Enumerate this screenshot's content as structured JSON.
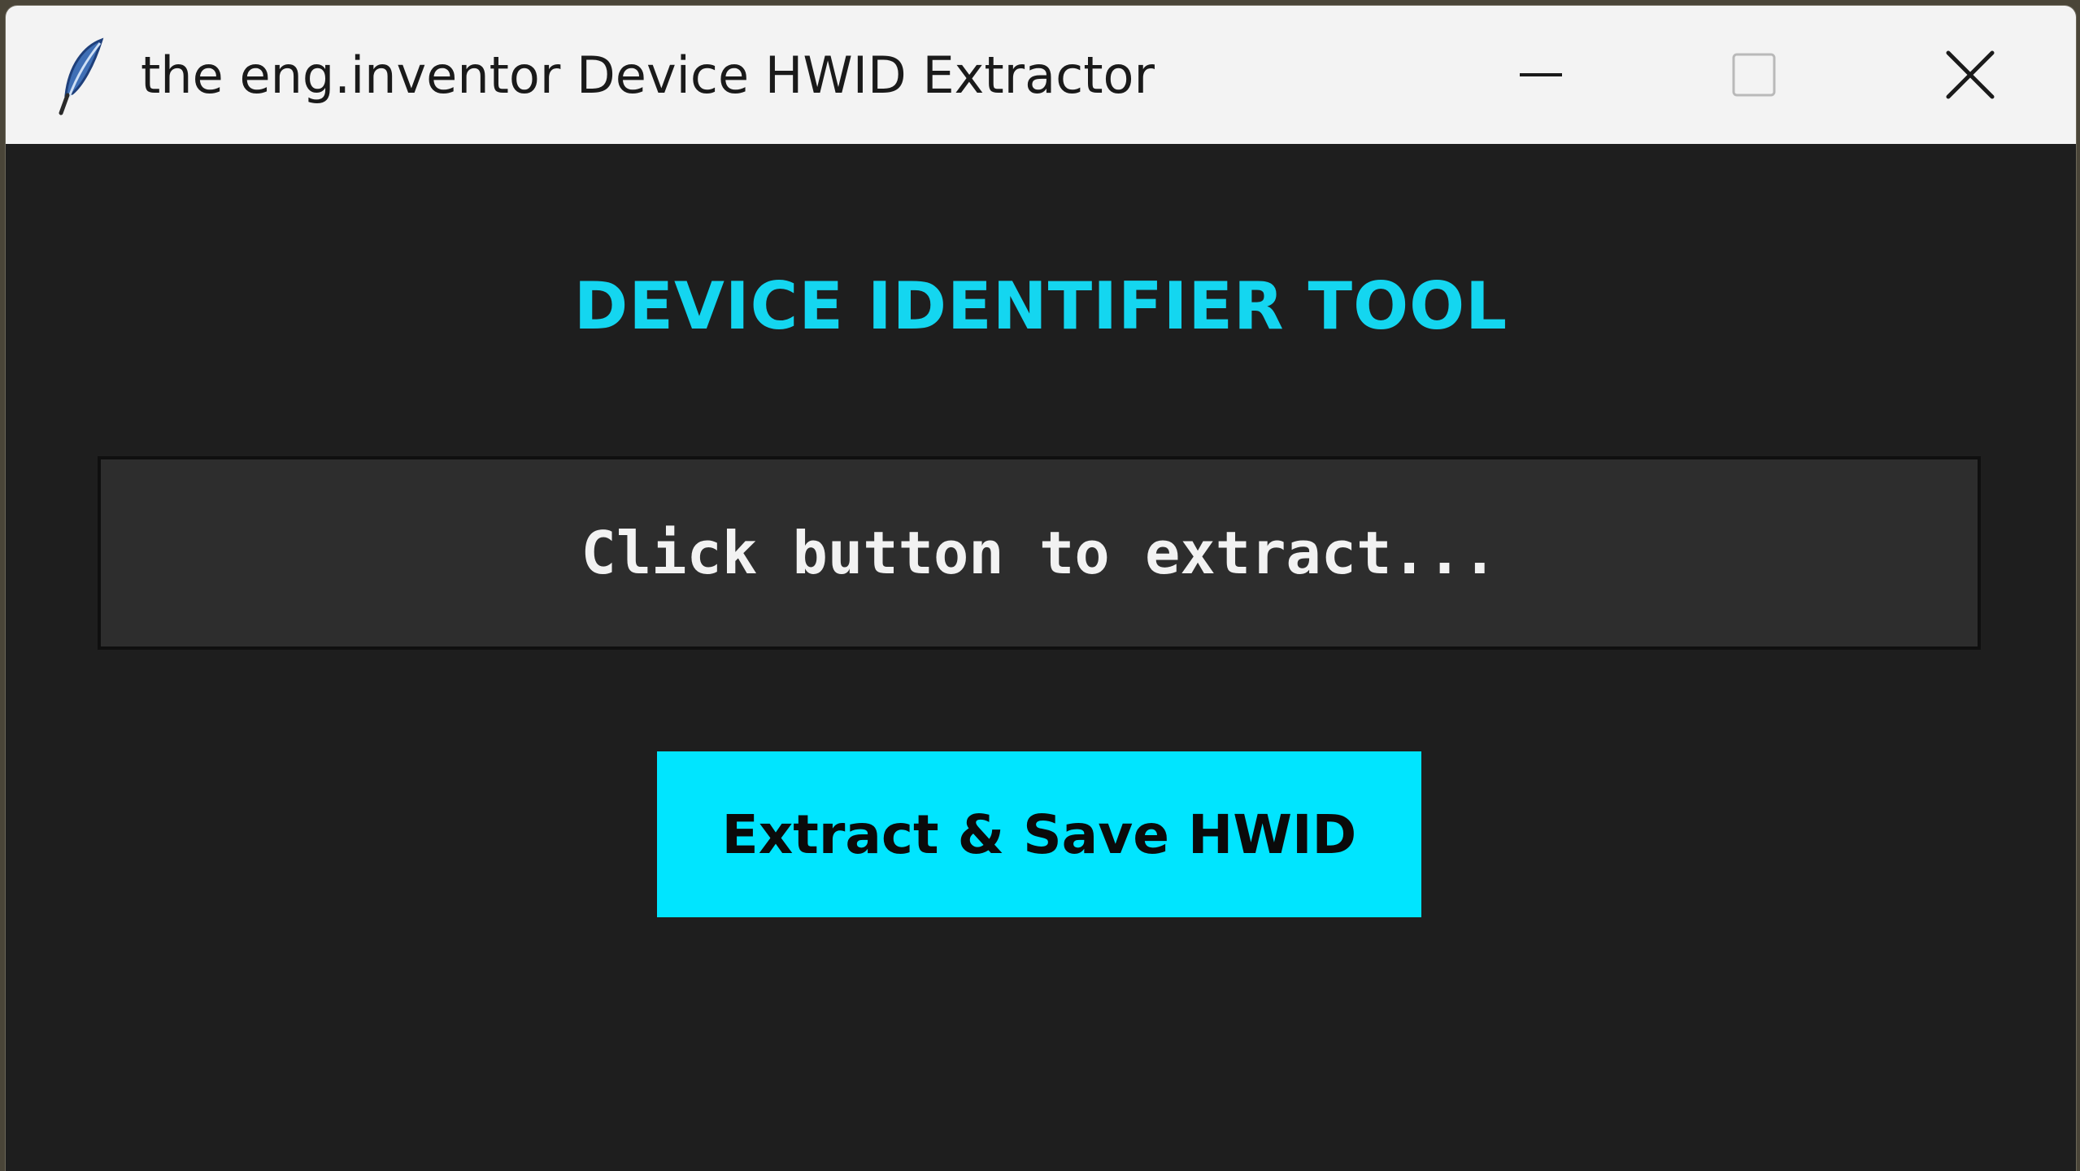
{
  "window": {
    "title": "the eng.inventor Device HWID Extractor",
    "icon": "feather-icon",
    "controls": {
      "minimize_icon": "minimize-icon",
      "maximize_icon": "maximize-icon",
      "close_icon": "close-icon"
    }
  },
  "main": {
    "heading": "DEVICE IDENTIFIER TOOL",
    "result_text": "Click button to extract...",
    "extract_button_label": "Extract & Save HWID"
  },
  "colors": {
    "accent": "#00e5ff",
    "heading": "#14d6f0",
    "background": "#1e1e1e",
    "result_box": "#2d2d2d",
    "titlebar": "#f3f3f3"
  }
}
